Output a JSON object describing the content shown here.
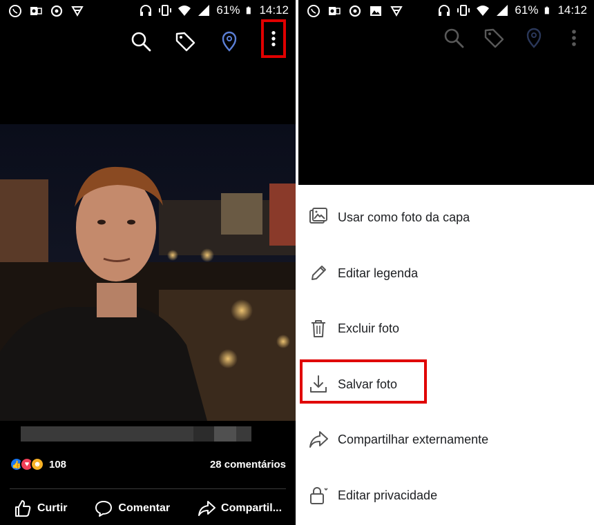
{
  "status_bar": {
    "battery": "61%",
    "time": "14:12"
  },
  "colors": {
    "highlight": "#e00000",
    "like_blue": "#1877f2",
    "love_red": "#f33e58",
    "haha_yellow": "#f7b125",
    "location_blue": "#5b7fd6"
  },
  "photo_view": {
    "toolbar_icons": [
      "search-icon",
      "tag-icon",
      "location-pin-icon",
      "more-vertical-icon"
    ],
    "reactions": {
      "icons": [
        "like-icon",
        "love-icon",
        "haha-icon"
      ],
      "count": "108"
    },
    "comments": "28 comentários",
    "actions": [
      {
        "label": "Curtir",
        "icon": "thumbs-up-icon"
      },
      {
        "label": "Comentar",
        "icon": "comment-icon"
      },
      {
        "label": "Compartil...",
        "icon": "share-arrow-icon"
      }
    ]
  },
  "menu": {
    "items": [
      {
        "label": "Usar como foto da capa",
        "icon": "cover-photo-icon"
      },
      {
        "label": "Editar legenda",
        "icon": "pencil-icon"
      },
      {
        "label": "Excluir foto",
        "icon": "trash-icon"
      },
      {
        "label": "Salvar foto",
        "icon": "download-icon"
      },
      {
        "label": "Compartilhar externamente",
        "icon": "share-arrow-icon"
      },
      {
        "label": "Editar privacidade",
        "icon": "lock-icon"
      }
    ]
  }
}
